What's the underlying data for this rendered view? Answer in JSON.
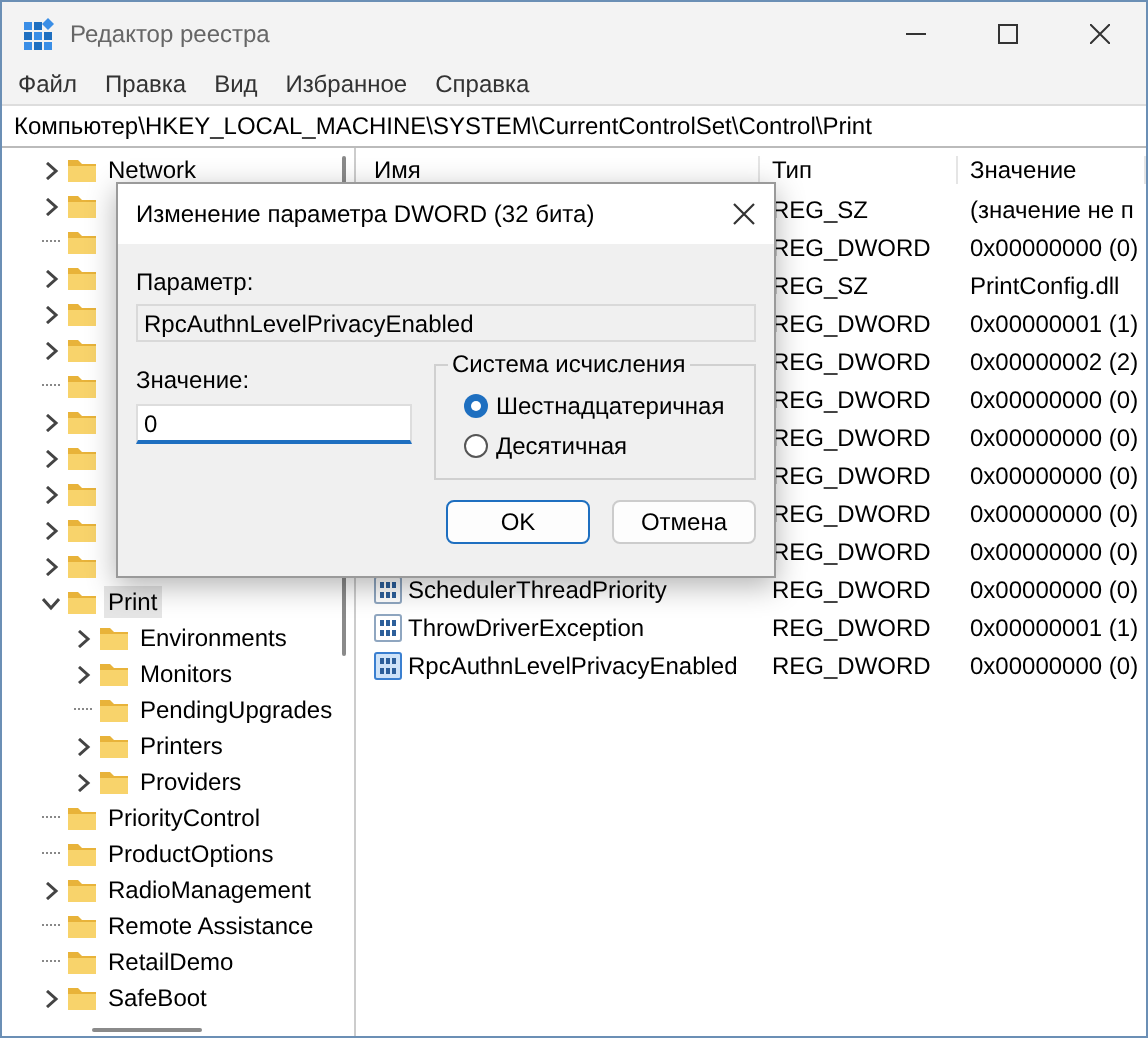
{
  "window": {
    "title": "Редактор реестра"
  },
  "menu": [
    "Файл",
    "Правка",
    "Вид",
    "Избранное",
    "Справка"
  ],
  "address": "Компьютер\\HKEY_LOCAL_MACHINE\\SYSTEM\\CurrentControlSet\\Control\\Print",
  "tree": {
    "items": [
      {
        "label": "Network",
        "expandable": true,
        "expanded": false,
        "selected": false
      },
      {
        "expandable": true,
        "expanded": false
      },
      {
        "expandable": false
      },
      {
        "expandable": true,
        "expanded": false
      },
      {
        "expandable": true,
        "expanded": false
      },
      {
        "expandable": true,
        "expanded": false
      },
      {
        "expandable": false
      },
      {
        "expandable": true,
        "expanded": false
      },
      {
        "expandable": true,
        "expanded": false
      },
      {
        "expandable": true,
        "expanded": false
      },
      {
        "expandable": true,
        "expanded": false
      },
      {
        "expandable": true,
        "expanded": false
      },
      {
        "label": "Print",
        "expandable": true,
        "expanded": true,
        "selected": true,
        "children": [
          {
            "label": "Environments",
            "expandable": true,
            "expanded": false,
            "selected": false
          },
          {
            "label": "Monitors",
            "expandable": true,
            "expanded": false,
            "selected": false
          },
          {
            "label": "PendingUpgrades",
            "expandable": false,
            "selected": false
          },
          {
            "label": "Printers",
            "expandable": true,
            "expanded": false,
            "selected": false
          },
          {
            "label": "Providers",
            "expandable": true,
            "expanded": false,
            "selected": false
          }
        ]
      },
      {
        "label": "PriorityControl",
        "expandable": false,
        "selected": false
      },
      {
        "label": "ProductOptions",
        "expandable": false,
        "selected": false
      },
      {
        "label": "RadioManagement",
        "expandable": true,
        "expanded": false,
        "selected": false
      },
      {
        "label": "Remote Assistance",
        "expandable": false,
        "selected": false
      },
      {
        "label": "RetailDemo",
        "expandable": false,
        "selected": false
      },
      {
        "label": "SafeBoot",
        "expandable": true,
        "expanded": false,
        "selected": false
      }
    ]
  },
  "list": {
    "columns": [
      "Имя",
      "Тип",
      "Значение"
    ],
    "rows": [
      {
        "type": "REG_SZ",
        "value": "(значение не п"
      },
      {
        "type": "REG_DWORD",
        "value": "0x00000000 (0)"
      },
      {
        "type": "REG_SZ",
        "value": "PrintConfig.dll"
      },
      {
        "type": "REG_DWORD",
        "value": "0x00000001 (1)"
      },
      {
        "type": "REG_DWORD",
        "value": "0x00000002 (2)"
      },
      {
        "type": "REG_DWORD",
        "value": "0x00000000 (0)"
      },
      {
        "type": "REG_DWORD",
        "value": "0x00000000 (0)"
      },
      {
        "type": "REG_DWORD",
        "value": "0x00000000 (0)"
      },
      {
        "type": "REG_DWORD",
        "value": "0x00000000 (0)"
      },
      {
        "type": "REG_DWORD",
        "value": "0x00000000 (0)"
      },
      {
        "name": "SchedulerThreadPriority",
        "type": "REG_DWORD",
        "value": "0x00000000 (0)",
        "selected": false
      },
      {
        "name": "ThrowDriverException",
        "type": "REG_DWORD",
        "value": "0x00000001 (1)",
        "selected": false
      },
      {
        "name": "RpcAuthnLevelPrivacyEnabled",
        "type": "REG_DWORD",
        "value": "0x00000000 (0)",
        "selected": true
      }
    ]
  },
  "dialog": {
    "title": "Изменение параметра DWORD (32 бита)",
    "parameter_label": "Параметр:",
    "parameter_value": "RpcAuthnLevelPrivacyEnabled",
    "value_label": "Значение:",
    "value": "0",
    "base_group": {
      "title": "Система исчисления",
      "options": [
        {
          "label": "Шестнадцатеричная",
          "selected": true
        },
        {
          "label": "Десятичная",
          "selected": false
        }
      ]
    },
    "buttons": [
      {
        "label": "OK",
        "default": true
      },
      {
        "label": "Отмена",
        "default": false
      }
    ]
  }
}
